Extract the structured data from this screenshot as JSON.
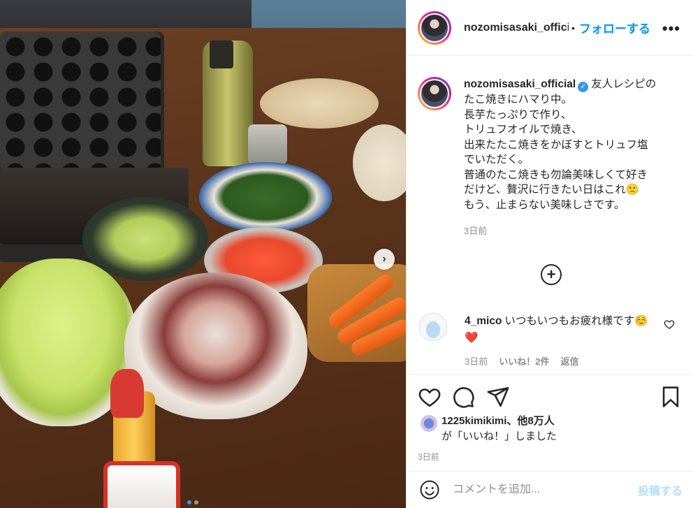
{
  "post": {
    "username": "nozomisasaki_official",
    "header_username": "nozomisasaki_offici",
    "separator": "•",
    "follow_label": "フォローする",
    "more_label": "•••",
    "verified_mark": "✓",
    "caption": "友人レシピの\nたこ焼きにハマり中。\n長芋たっぷりで作り、\nトリュフオイルで焼き、\n出来たたこ焼きをかぼすとトリュフ塩\nでいただく。\n普通のたこ焼きも勿論美味しくて好き\nだけど、贅沢に行きたい日はこれ🙁\nもう、止まらない美味しさです。",
    "caption_time": "3日前",
    "load_more": "+",
    "posted_time": "3日前"
  },
  "comment": {
    "username": "4_mico",
    "text": "いつもいつもお疲れ様です☺️❤️",
    "time": "3日前",
    "likes": "いいね！2件",
    "reply": "返信"
  },
  "likes": {
    "first_user": "1225kimikimi",
    "others": "、他8万人",
    "suffix": "が「いいね！」しました"
  },
  "comment_box": {
    "placeholder": "コメントを追加...",
    "post_label": "投稿する"
  },
  "carousel": {
    "next_label": "›",
    "slides": 2,
    "current": 1
  },
  "colors": {
    "accent": "#0095f6",
    "post_disabled": "#b2dffc",
    "muted": "#8e8e8e"
  }
}
